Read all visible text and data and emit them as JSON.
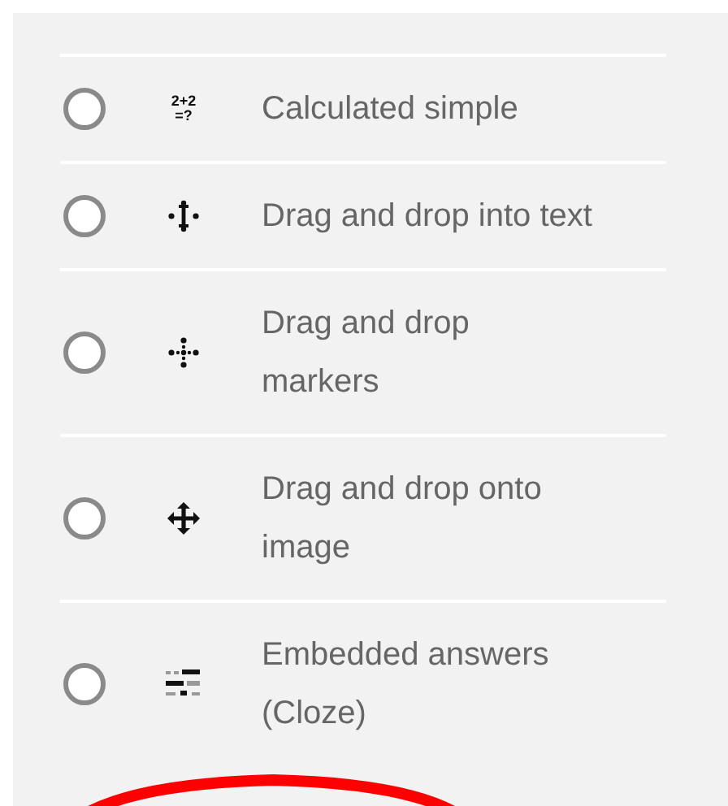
{
  "options": [
    {
      "label": "Calculated simple",
      "selected": false,
      "icon_text": [
        "2+2",
        "=?"
      ]
    },
    {
      "label": "Drag and drop into text",
      "selected": false
    },
    {
      "label": "Drag and drop markers",
      "selected": false
    },
    {
      "label": "Drag and drop onto image",
      "selected": false
    },
    {
      "label": "Embedded answers (Cloze)",
      "selected": false
    }
  ]
}
